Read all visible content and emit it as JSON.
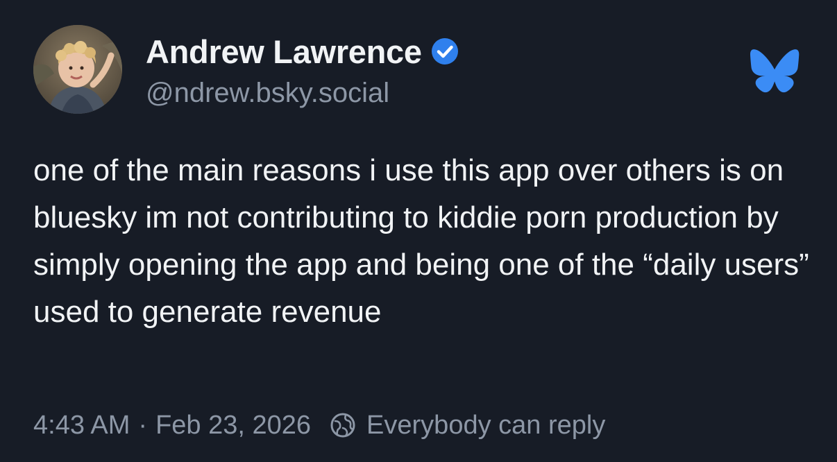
{
  "author": {
    "display_name": "Andrew Lawrence",
    "handle": "@ndrew.bsky.social",
    "verified": true
  },
  "post": {
    "text": "one of the main reasons i use this app over others is on bluesky im not contributing to kiddie porn production by simply opening the app and being one of the “daily users” used to generate revenue"
  },
  "meta": {
    "time": "4:43 AM",
    "separator": "·",
    "date": "Feb 23, 2026",
    "reply_setting": "Everybody can reply"
  },
  "colors": {
    "background": "#171c26",
    "text_primary": "#f1f3f5",
    "text_secondary": "#8d97a6",
    "verified_blue": "#2f80ed",
    "bluesky_blue": "#3b8cf5"
  },
  "icons": {
    "verified": "verified-checkmark-icon",
    "brand": "bluesky-butterfly-icon",
    "reply": "globe-reply-icon"
  }
}
